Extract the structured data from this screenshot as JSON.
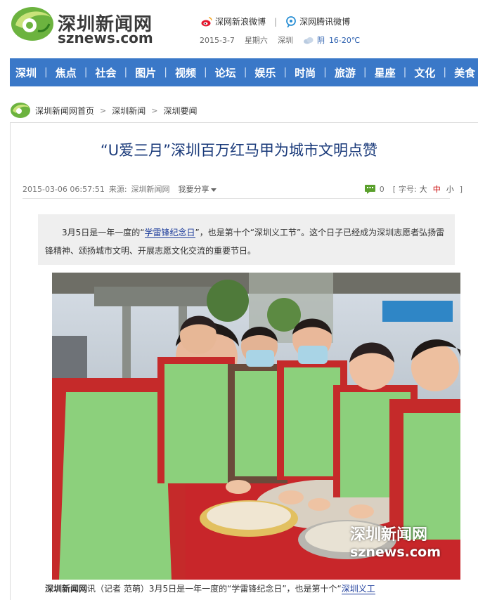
{
  "header": {
    "logo_cn": "深圳新闻网",
    "logo_en": "sznews.com",
    "weibo_sina": "深网新浪微博",
    "weibo_tencent": "深网腾讯微博",
    "date": "2015-3-7",
    "weekday": "星期六",
    "city": "深圳",
    "weather": "阴",
    "temperature": "16-20℃"
  },
  "nav": {
    "items": [
      {
        "label": "深圳"
      },
      {
        "label": "焦点"
      },
      {
        "label": "社会"
      },
      {
        "label": "图片"
      },
      {
        "label": "视频"
      },
      {
        "label": "论坛"
      },
      {
        "label": "娱乐"
      },
      {
        "label": "时尚"
      },
      {
        "label": "旅游"
      },
      {
        "label": "星座"
      },
      {
        "label": "文化"
      },
      {
        "label": "美食"
      }
    ]
  },
  "breadcrumb": {
    "items": [
      {
        "label": "深圳新闻网首页"
      },
      {
        "label": "深圳新闻"
      },
      {
        "label": "深圳要闻"
      }
    ]
  },
  "article": {
    "title": "“U爱三月”深圳百万红马甲为城市文明点赞",
    "datetime": "2015-03-06 06:57:51",
    "source_label": "来源:",
    "source": "深圳新闻网",
    "share_label": "我要分享",
    "comment_count": "0",
    "font_open": "[",
    "font_label": "字号:",
    "font_large": "大",
    "font_medium": "中",
    "font_small": "小",
    "font_close": "]",
    "summary_pre": "3月5日是一年一度的“",
    "summary_link": "学雷锋纪念日",
    "summary_post": "”，也是第十个“深圳义工节”。这个日子已经成为深圳志愿者弘扬雷锋精神、颂扬城市文明、开展志愿文化交流的重要节日。",
    "photo_watermark_cn": "深圳新闻网",
    "photo_watermark_en": "sznews.com",
    "body_source": "深圳新闻网",
    "body_pre": "讯（记者  范萌）3月5日是一年一度的“学雷锋纪念日”，也是第十个“",
    "body_link": "深圳义工"
  },
  "colors": {
    "nav_bg": "#3a78c8",
    "title": "#1a3a7a",
    "link": "#1a3a9a",
    "brand_green": "#5aa02c"
  }
}
